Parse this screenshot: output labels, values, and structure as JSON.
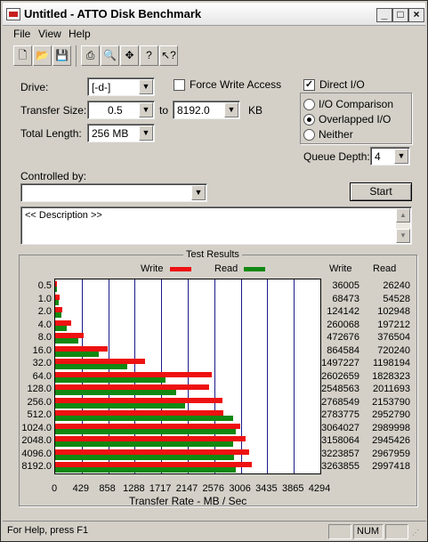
{
  "window": {
    "title": "Untitled - ATTO Disk Benchmark"
  },
  "menu": [
    "File",
    "View",
    "Help"
  ],
  "toolbar_icons": [
    "new-icon",
    "open-icon",
    "save-icon",
    "print-icon",
    "print-preview-icon",
    "move-icon",
    "help-icon",
    "context-help-icon"
  ],
  "form": {
    "drive_label": "Drive:",
    "drive_value": "[-d-]",
    "force_write_label": "Force Write Access",
    "force_write_checked": false,
    "direct_io_label": "Direct I/O",
    "direct_io_checked": true,
    "transfer_size_label": "Transfer Size:",
    "transfer_from": "0.5",
    "to_label": "to",
    "transfer_to": "8192.0",
    "kb_label": "KB",
    "total_length_label": "Total Length:",
    "total_length_value": "256 MB",
    "io_options": [
      "I/O Comparison",
      "Overlapped I/O",
      "Neither"
    ],
    "io_selected": "Overlapped I/O",
    "queue_depth_label": "Queue Depth:",
    "queue_depth_value": "4",
    "controlled_by_label": "Controlled by:",
    "controlled_by_value": "",
    "start_label": "Start",
    "description_text": "<< Description >>"
  },
  "results": {
    "title": "Test Results",
    "legend_write": "Write",
    "legend_read": "Read",
    "col_write": "Write",
    "col_read": "Read",
    "xlabel": "Transfer Rate - MB / Sec",
    "colors": {
      "write": "#ee1111",
      "read": "#118811",
      "grid": "#1a1a8a"
    }
  },
  "chart_data": {
    "type": "bar",
    "orientation": "horizontal",
    "categories": [
      "0.5",
      "1.0",
      "2.0",
      "4.0",
      "8.0",
      "16.0",
      "32.0",
      "64.0",
      "128.0",
      "256.0",
      "512.0",
      "1024.0",
      "2048.0",
      "4096.0",
      "8192.0"
    ],
    "series": [
      {
        "name": "Write",
        "values": [
          36005,
          68473,
          124142,
          260068,
          472676,
          864584,
          1497227,
          2602659,
          2548563,
          2768549,
          2783775,
          3064027,
          3158064,
          3223857,
          3263855
        ]
      },
      {
        "name": "Read",
        "values": [
          26240,
          54528,
          102948,
          197212,
          376504,
          720240,
          1198194,
          1828323,
          2011693,
          2153790,
          2952790,
          2989998,
          2945426,
          2967959,
          2997418
        ]
      }
    ],
    "x_ticks": [
      "0",
      "429",
      "858",
      "1288",
      "1717",
      "2147",
      "2576",
      "3006",
      "3435",
      "3865",
      "4294"
    ],
    "xlim": [
      0,
      4294
    ],
    "xlabel": "Transfer Rate - MB / Sec",
    "grid": true
  },
  "status": {
    "help": "For Help, press F1",
    "num": "NUM"
  }
}
